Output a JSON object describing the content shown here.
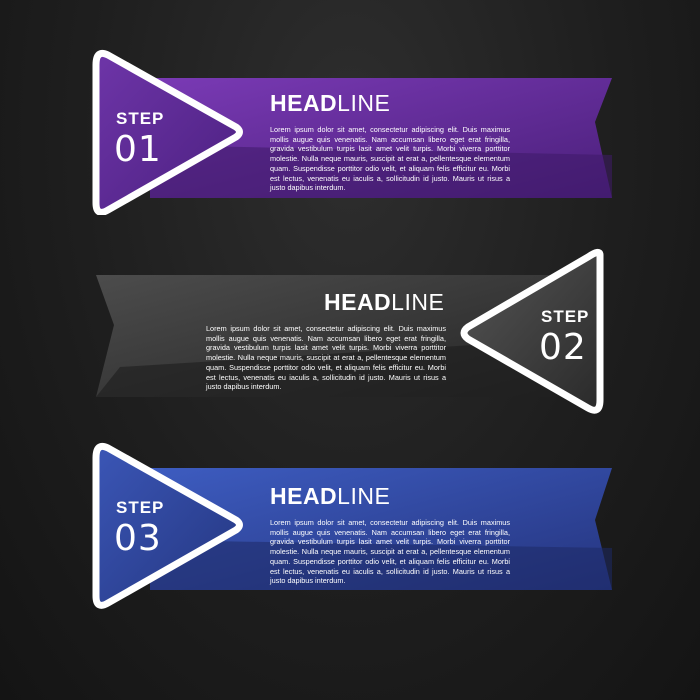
{
  "colors": {
    "background": "#1e1e1e",
    "step1_accent": "#6a2fa0",
    "step2_accent": "#4a4a4a",
    "step3_accent": "#3a52b0",
    "outline": "#ffffff"
  },
  "steps": [
    {
      "step_label": "STEP",
      "number": "01",
      "headline_bold": "HEAD",
      "headline_light": "LINE",
      "body": "Lorem ipsum dolor sit amet, consectetur adipiscing elit. Duis maximus mollis augue quis venenatis. Nam accumsan libero eget erat fringilla, gravida vestibulum turpis lasit amet velit turpis. Morbi viverra porttitor molestie. Nulla neque mauris, suscipit at erat a, pellentesque elementum quam. Suspendisse porttitor odio velit, et aliquam felis efficitur eu. Morbi est lectus, venenatis eu iaculis a, sollicitudin id justo. Mauris ut risus a justo dapibus interdum."
    },
    {
      "step_label": "STEP",
      "number": "02",
      "headline_bold": "HEAD",
      "headline_light": "LINE",
      "body": "Lorem ipsum dolor sit amet, consectetur adipiscing elit. Duis maximus mollis augue quis venenatis. Nam accumsan libero eget erat fringilla, gravida vestibulum turpis lasit amet velit turpis. Morbi viverra porttitor molestie. Nulla neque mauris, suscipit at erat a, pellentesque elementum quam. Suspendisse porttitor odio velit, et aliquam felis efficitur eu. Morbi est lectus, venenatis eu iaculis a, sollicitudin id justo. Mauris ut risus a justo dapibus interdum."
    },
    {
      "step_label": "STEP",
      "number": "03",
      "headline_bold": "HEAD",
      "headline_light": "LINE",
      "body": "Lorem ipsum dolor sit amet, consectetur adipiscing elit. Duis maximus mollis augue quis venenatis. Nam accumsan libero eget erat fringilla, gravida vestibulum turpis lasit amet velit turpis. Morbi viverra porttitor molestie. Nulla neque mauris, suscipit at erat a, pellentesque elementum quam. Suspendisse porttitor odio velit, et aliquam felis efficitur eu. Morbi est lectus, venenatis eu iaculis a, sollicitudin id justo. Mauris ut risus a justo dapibus interdum."
    }
  ]
}
